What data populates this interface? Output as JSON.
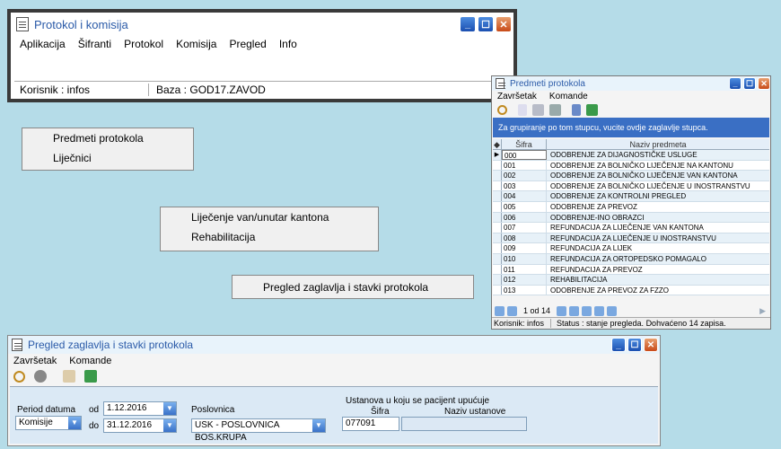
{
  "main_window": {
    "title": "Protokol i komisija",
    "menu": [
      "Aplikacija",
      "Šifranti",
      "Protokol",
      "Komisija",
      "Pregled",
      "Info"
    ],
    "status_user": "Korisnik : infos",
    "status_db": "Baza : GOD17.ZAVOD"
  },
  "menu_group1": [
    "Predmeti protokola",
    "Liječnici"
  ],
  "menu_group2": [
    "Liječenje van/unutar kantona",
    "Rehabilitacija"
  ],
  "menu_group3": [
    "Pregled zaglavlja i stavki protokola"
  ],
  "predmeti_window": {
    "title": "Predmeti protokola",
    "menu": [
      "Završetak",
      "Komande"
    ],
    "group_hint": "Za grupiranje po tom stupcu, vucite ovdje zaglavlje stupca.",
    "col_sifra": "Šifra",
    "col_naziv": "Naziv predmeta",
    "rows": [
      {
        "sifra": "000",
        "naziv": "ODOBRENJE ZA DIJAGNOSTIČKE USLUGE"
      },
      {
        "sifra": "001",
        "naziv": "ODOBRENJE ZA BOLNIČKO LIJEČENJE NA KANTONU"
      },
      {
        "sifra": "002",
        "naziv": "ODOBRENJE ZA BOLNIČKO LIJEČENJE VAN KANTONA"
      },
      {
        "sifra": "003",
        "naziv": "ODOBRENJE ZA BOLNIČKO LIJEČENJE U INOSTRANSTVU"
      },
      {
        "sifra": "004",
        "naziv": "ODOBRENJE ZA KONTROLNI PREGLED"
      },
      {
        "sifra": "005",
        "naziv": "ODOBRENJE ZA PREVOZ"
      },
      {
        "sifra": "006",
        "naziv": "ODOBRENJE-INO OBRAZCI"
      },
      {
        "sifra": "007",
        "naziv": "REFUNDACIJA ZA LIJEČENJE VAN KANTONA"
      },
      {
        "sifra": "008",
        "naziv": "REFUNDACIJA ZA LIJEČENJE U INOSTRANSTVU"
      },
      {
        "sifra": "009",
        "naziv": "REFUNDACIJA ZA LIJEK"
      },
      {
        "sifra": "010",
        "naziv": "REFUNDACIJA ZA ORTOPEDSKO POMAGALO"
      },
      {
        "sifra": "011",
        "naziv": "REFUNDACIJA ZA PREVOZ"
      },
      {
        "sifra": "012",
        "naziv": "REHABILITACIJA"
      },
      {
        "sifra": "013",
        "naziv": "ODOBRENJE ZA PREVOZ ZA FZZO"
      }
    ],
    "pager": "1 od 14",
    "status_user": "Korisnik: infos",
    "status_text": "Status : stanje pregleda. Dohvaćeno 14 zapisa."
  },
  "pregled_window": {
    "title": "Pregled zaglavlja i stavki protokola",
    "menu": [
      "Završetak",
      "Komande"
    ],
    "period_label": "Period datuma",
    "period_type": "Komisije",
    "od_label": "od",
    "do_label": "do",
    "date_from": "1.12.2016",
    "date_to": "31.12.2016",
    "poslovnica_label": "Poslovnica",
    "poslovnica_value": "USK - POSLOVNICA BOS.KRUPA",
    "ustanova_label": "Ustanova u koju se pacijent upućuje",
    "sifra_label": "Šifra",
    "naziv_label": "Naziv ustanove",
    "sifra_value": "077091"
  },
  "colors": {
    "accent": "#3a6fc4",
    "background": "#b5dce8",
    "close_btn": "#c84a18"
  }
}
